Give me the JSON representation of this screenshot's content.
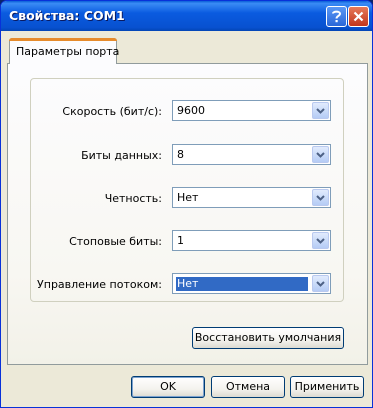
{
  "window": {
    "title": "Свойства: COM1"
  },
  "titlebar": {
    "help_icon": "question-icon",
    "close_icon": "close-icon"
  },
  "tabs": [
    {
      "label": "Параметры порта",
      "active": true
    }
  ],
  "fields": [
    {
      "label": "Скорость (бит/с):",
      "value": "9600"
    },
    {
      "label": "Биты данных:",
      "value": "8"
    },
    {
      "label": "Четность:",
      "value": "Нет"
    },
    {
      "label": "Стоповые биты:",
      "value": "1"
    },
    {
      "label": "Управление потоком:",
      "value": "Нет"
    }
  ],
  "restore_defaults_label": "Восстановить умолчания",
  "buttons": {
    "ok": "OK",
    "cancel": "Отмена",
    "apply": "Применить"
  },
  "colors": {
    "title_bar": "#0a5be0",
    "close_button": "#c2351b",
    "tab_highlight": "#e68b2c",
    "selection": "#316ac5"
  }
}
